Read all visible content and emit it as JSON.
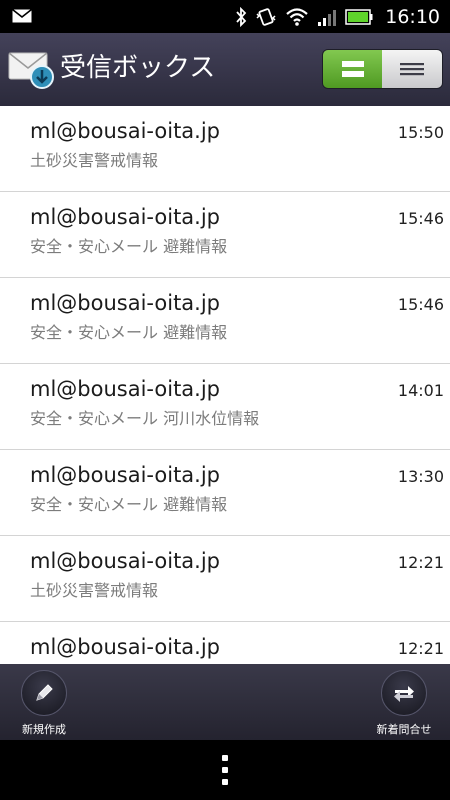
{
  "status_bar": {
    "time": "16:10",
    "icons": [
      "mail-notification-icon",
      "bluetooth-icon",
      "vibrate-icon",
      "wifi-icon",
      "signal-icon",
      "battery-icon"
    ]
  },
  "header": {
    "title": "受信ボックス",
    "app_icon": "mail-inbox-icon",
    "toggle": [
      "detail-view-icon",
      "list-view-icon"
    ],
    "accent": "#5aa82c"
  },
  "messages": [
    {
      "sender": "ml@bousai-oita.jp",
      "time": "15:50",
      "subject": "土砂災害警戒情報"
    },
    {
      "sender": "ml@bousai-oita.jp",
      "time": "15:46",
      "subject": "安全・安心メール 避難情報"
    },
    {
      "sender": "ml@bousai-oita.jp",
      "time": "15:46",
      "subject": "安全・安心メール 避難情報"
    },
    {
      "sender": "ml@bousai-oita.jp",
      "time": "14:01",
      "subject": "安全・安心メール 河川水位情報"
    },
    {
      "sender": "ml@bousai-oita.jp",
      "time": "13:30",
      "subject": "安全・安心メール 避難情報"
    },
    {
      "sender": "ml@bousai-oita.jp",
      "time": "12:21",
      "subject": "土砂災害警戒情報"
    },
    {
      "sender": "ml@bousai-oita.jp",
      "time": "12:21",
      "subject": ""
    }
  ],
  "actions": {
    "compose_label": "新規作成",
    "refresh_label": "新着問合せ"
  }
}
